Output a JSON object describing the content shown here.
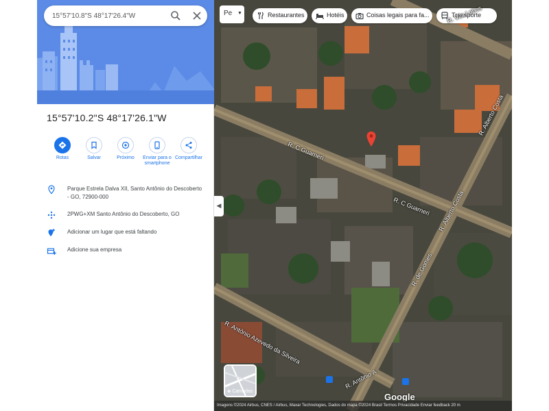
{
  "search": {
    "value": "15°57'10.8\"S 48°17'26.4\"W",
    "search_icon": "search-icon",
    "close_icon": "close-icon"
  },
  "place": {
    "title": "15°57'10.2\"S 48°17'26.1\"W"
  },
  "actions": [
    {
      "label": "Rotas",
      "icon": "directions-icon"
    },
    {
      "label": "Salvar",
      "icon": "bookmark-icon"
    },
    {
      "label": "Próximo",
      "icon": "nearby-icon"
    },
    {
      "label": "Enviar para o smartphone",
      "icon": "send-to-phone-icon"
    },
    {
      "label": "Compartilhar",
      "icon": "share-icon"
    }
  ],
  "info": [
    {
      "text": "Parque Estrela Dalva XII, Santo Antônio do Descoberto - GO, 72900-000",
      "icon": "location-pin-icon"
    },
    {
      "text": "2PWG+XM Santo Antônio do Descoberto, GO",
      "icon": "plus-code-icon"
    },
    {
      "text": "Adicionar um lugar que está faltando",
      "icon": "add-place-icon"
    },
    {
      "text": "Adicione sua empresa",
      "icon": "add-business-icon"
    }
  ],
  "map": {
    "layer_select": "Pe",
    "chips": [
      {
        "label": "Restaurantes",
        "icon": "restaurant-icon"
      },
      {
        "label": "Hotéis",
        "icon": "hotel-icon"
      },
      {
        "label": "Coisas legais para fa...",
        "icon": "camera-icon"
      },
      {
        "label": "Transporte",
        "icon": "transit-icon"
      }
    ],
    "streets": [
      "R. C Guarneri",
      "R. C Guarneri",
      "R. Vila Lobos",
      "R. Alberto Costa",
      "R. Alberto Costa",
      "R. de Gomes",
      "R. Antônio Azevedo da Silveira",
      "R. Antônio A"
    ],
    "layers_label": "Camadas",
    "google_logo": "Google",
    "attribution": "Imagens ©2024 Airbus, CNES / Airbus, Maxar Technologies, Dados do mapa ©2024   Brasil   Termos   Privacidade   Enviar feedback   20 m"
  }
}
